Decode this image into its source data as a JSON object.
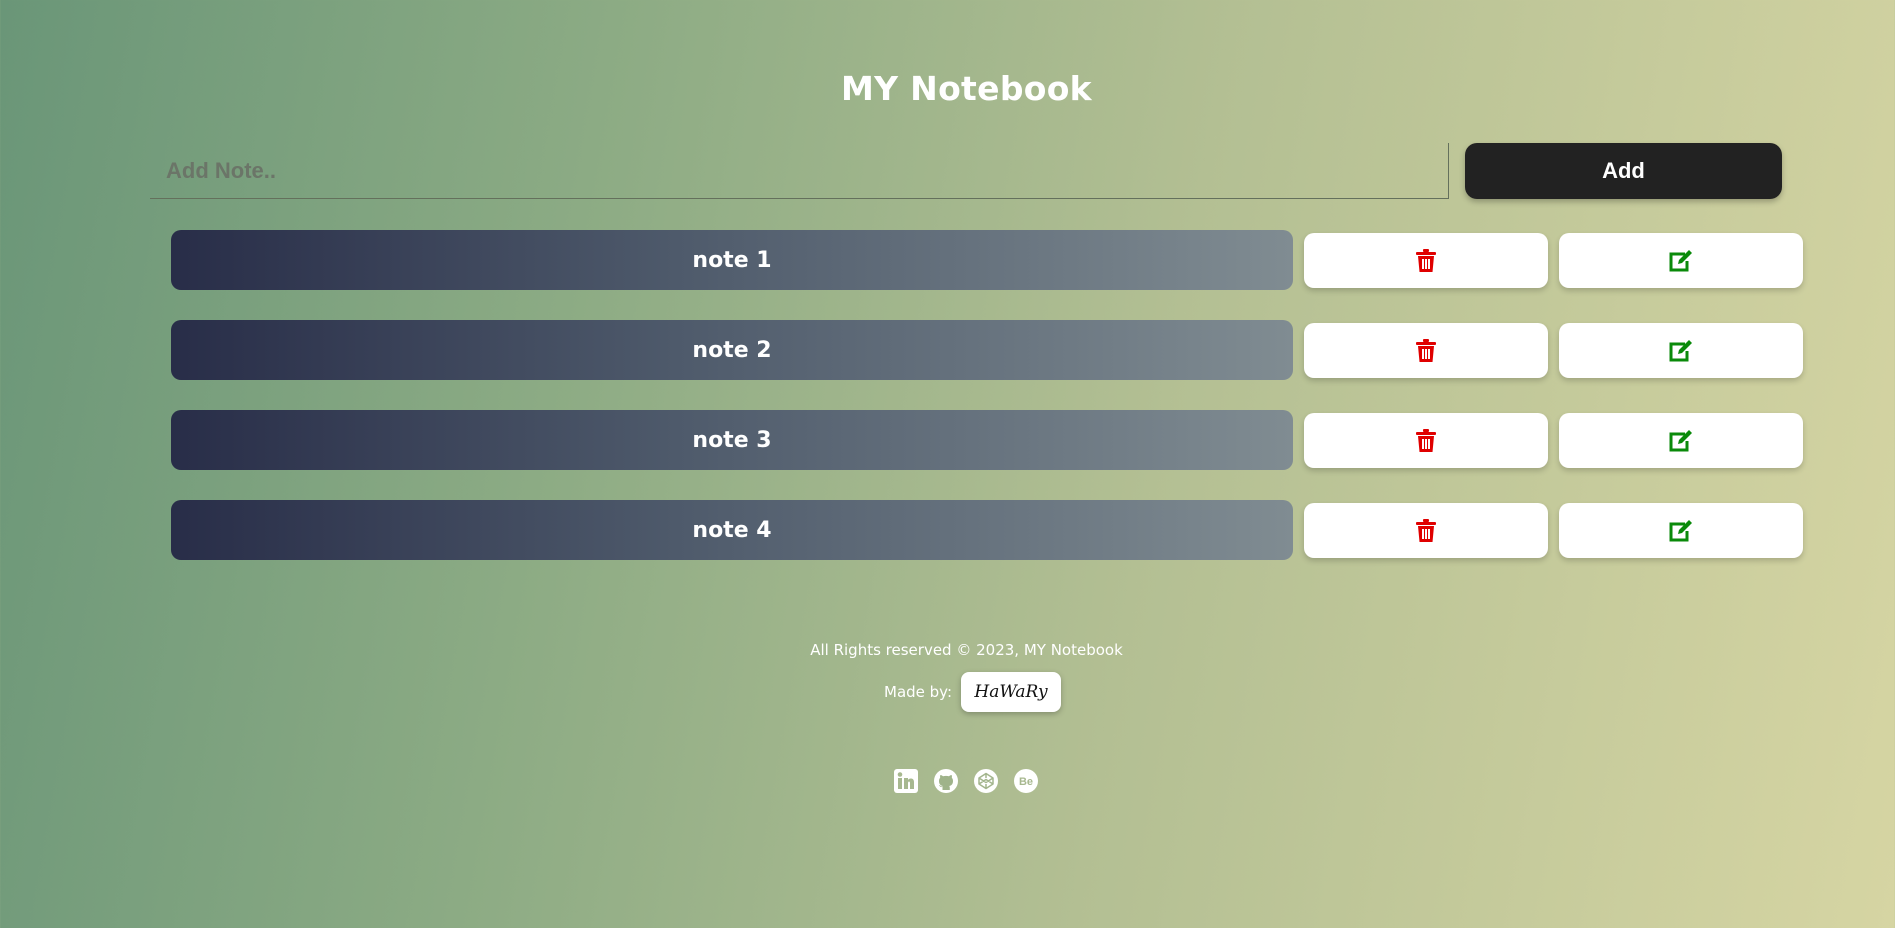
{
  "app": {
    "title": "MY Notebook"
  },
  "add_form": {
    "placeholder": "Add Note..",
    "value": "",
    "button_label": "Add"
  },
  "notes": [
    {
      "label": "note 1"
    },
    {
      "label": "note 2"
    },
    {
      "label": "note 3"
    },
    {
      "label": "note 4"
    }
  ],
  "note_actions": {
    "delete_icon": "trash-icon",
    "edit_icon": "edit-icon",
    "delete_color": "#e00000",
    "edit_color": "#0a8a0a"
  },
  "footer": {
    "rights": "All Rights reserved © 2023, MY Notebook",
    "made_by_label": "Made by:",
    "signature": "HaWaRy",
    "social": [
      "linkedin-icon",
      "github-icon",
      "codepen-icon",
      "behance-icon"
    ]
  }
}
